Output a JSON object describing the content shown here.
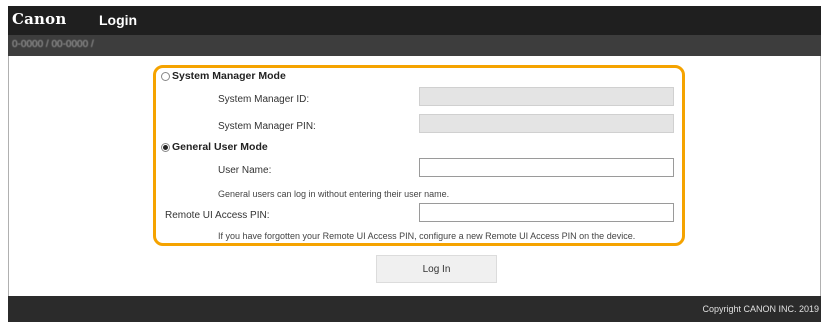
{
  "header": {
    "logo": "Canon",
    "title": "Login",
    "breadcrumb": "0-0000 / 00-0000 /"
  },
  "login_form": {
    "system_manager_mode": {
      "label": "System Manager Mode",
      "selected": false,
      "id_label": "System Manager ID:",
      "id_value": "",
      "pin_label": "System Manager PIN:",
      "pin_value": ""
    },
    "general_user_mode": {
      "label": "General User Mode",
      "selected": true,
      "user_name_label": "User Name:",
      "user_name_value": "",
      "hint": "General users can log in without entering their user name."
    },
    "remote_ui_pin": {
      "label": "Remote UI Access PIN:",
      "value": "",
      "hint": "If you have forgotten your Remote UI Access PIN, configure a new Remote UI Access PIN on the device."
    },
    "login_button": "Log In"
  },
  "footer": {
    "copyright": "Copyright CANON INC. 2019"
  },
  "colors": {
    "accent": "#f5a300",
    "topbar": "#1f1f1f",
    "subbar": "#3d3d3d",
    "footer": "#2b2b2b"
  }
}
